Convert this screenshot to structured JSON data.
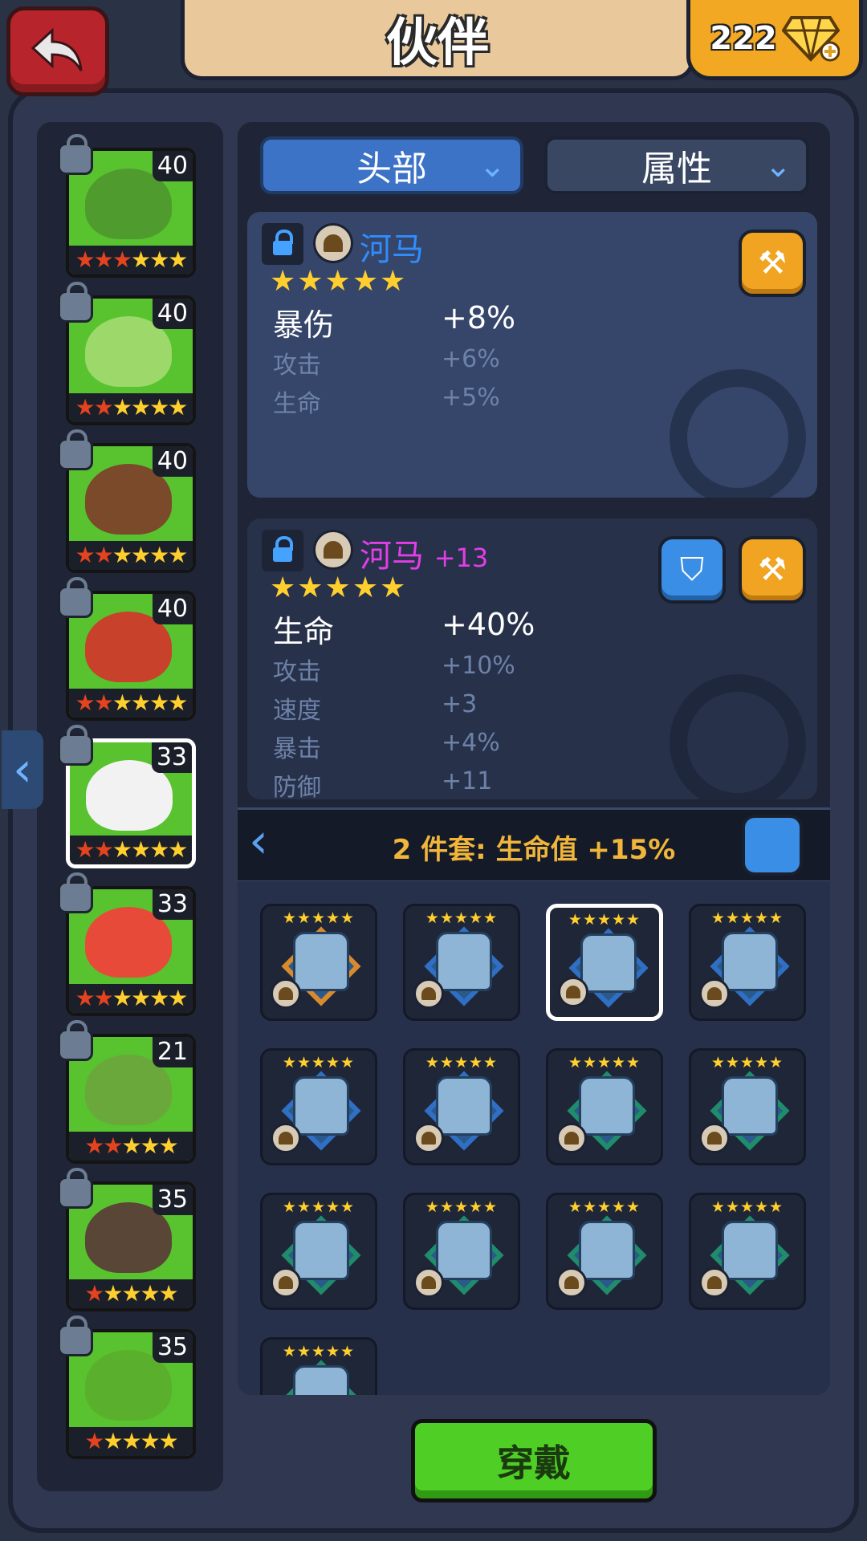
{
  "header": {
    "title": "伙伴",
    "gems": "222"
  },
  "filters": {
    "slot": "头部",
    "sort": "属性"
  },
  "heroes": [
    {
      "level": "40",
      "stars": 6,
      "red_stars": 3,
      "color": "#4f9b2e"
    },
    {
      "level": "40",
      "stars": 6,
      "red_stars": 2,
      "color": "#9cd86a"
    },
    {
      "level": "40",
      "stars": 6,
      "red_stars": 2,
      "color": "#7a4a2a"
    },
    {
      "level": "40",
      "stars": 6,
      "red_stars": 2,
      "color": "#c8412b"
    },
    {
      "level": "33",
      "stars": 6,
      "red_stars": 2,
      "color": "#f2f2f2"
    },
    {
      "level": "33",
      "stars": 6,
      "red_stars": 2,
      "color": "#e84a3a"
    },
    {
      "level": "21",
      "stars": 5,
      "red_stars": 2,
      "color": "#6aa83c"
    },
    {
      "level": "35",
      "stars": 5,
      "red_stars": 1,
      "color": "#5a4636"
    },
    {
      "level": "35",
      "stars": 5,
      "red_stars": 1,
      "color": "#5ab02c"
    }
  ],
  "equipped": {
    "name": "河马",
    "stars": "★★★★★",
    "main_stat": {
      "label": "暴伤",
      "value": "+8%"
    },
    "sub_stats": [
      {
        "label": "攻击",
        "value": "+6%"
      },
      {
        "label": "生命",
        "value": "+5%"
      }
    ]
  },
  "selected_item": {
    "name": "河马",
    "enhance": "+13",
    "stars": "★★★★★",
    "main_stat": {
      "label": "生命",
      "value": "+40%"
    },
    "sub_stats": [
      {
        "label": "攻击",
        "value": "+10%"
      },
      {
        "label": "速度",
        "value": "+3"
      },
      {
        "label": "暴击",
        "value": "+4%"
      },
      {
        "label": "防御",
        "value": "+11"
      }
    ]
  },
  "set_bonus": "2 件套: 生命值 +15%",
  "inventory_stars": "★★★★★",
  "inventory": [
    {
      "frame": "orange"
    },
    {
      "frame": "blue"
    },
    {
      "frame": "blue",
      "selected": true
    },
    {
      "frame": "blue"
    },
    {
      "frame": "blue"
    },
    {
      "frame": "blue"
    },
    {
      "frame": "green"
    },
    {
      "frame": "green"
    },
    {
      "frame": "green"
    },
    {
      "frame": "green"
    },
    {
      "frame": "green"
    },
    {
      "frame": "green"
    },
    {
      "frame": "green"
    }
  ],
  "actions": {
    "wear": "穿戴"
  },
  "colors": {
    "equipped_name": "#2f8dff",
    "selected_name": "#e23ee8",
    "set_text": "#f0b53a"
  },
  "icons": {
    "back": "back-arrow-icon",
    "gem": "diamond-icon",
    "lock": "lock-icon",
    "upgrade": "hammer-icon",
    "unequip": "armor-unequip-icon",
    "set": "set-icon",
    "helmet": "helmet-icon"
  }
}
